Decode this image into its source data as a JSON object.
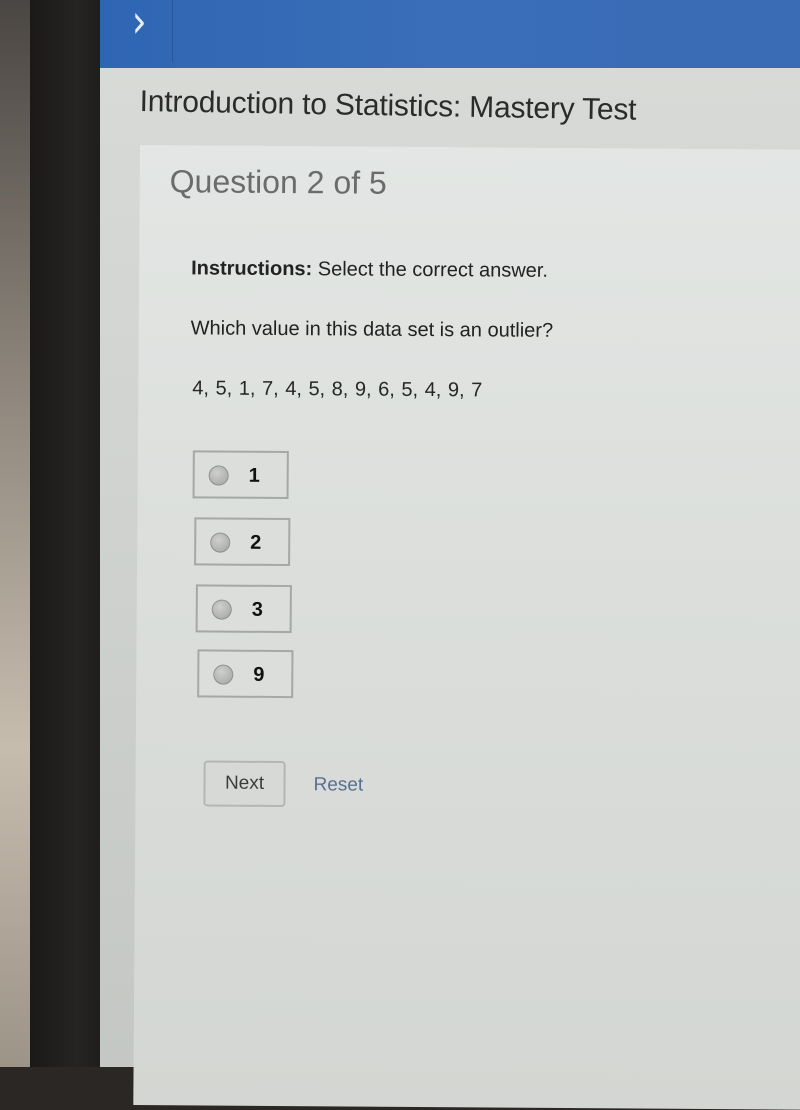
{
  "header": {
    "expand_icon": "chevron-right-icon",
    "course_title": "Introduction to Statistics: Mastery Test"
  },
  "question": {
    "number_label": "Question 2 of 5",
    "instructions_label": "Instructions:",
    "instructions_text": " Select the correct answer.",
    "prompt": "Which value in this data set is an outlier?",
    "dataset": "4, 5, 1, 7, 4, 5, 8, 9, 6, 5, 4, 9, 7",
    "options": [
      {
        "label": "1",
        "selected": false
      },
      {
        "label": "2",
        "selected": false
      },
      {
        "label": "3",
        "selected": false
      },
      {
        "label": "9",
        "selected": false
      }
    ]
  },
  "actions": {
    "next_label": "Next",
    "reset_label": "Reset"
  },
  "colors": {
    "header_blue": "#3a6bb5",
    "link_color": "#5a6f8f"
  }
}
